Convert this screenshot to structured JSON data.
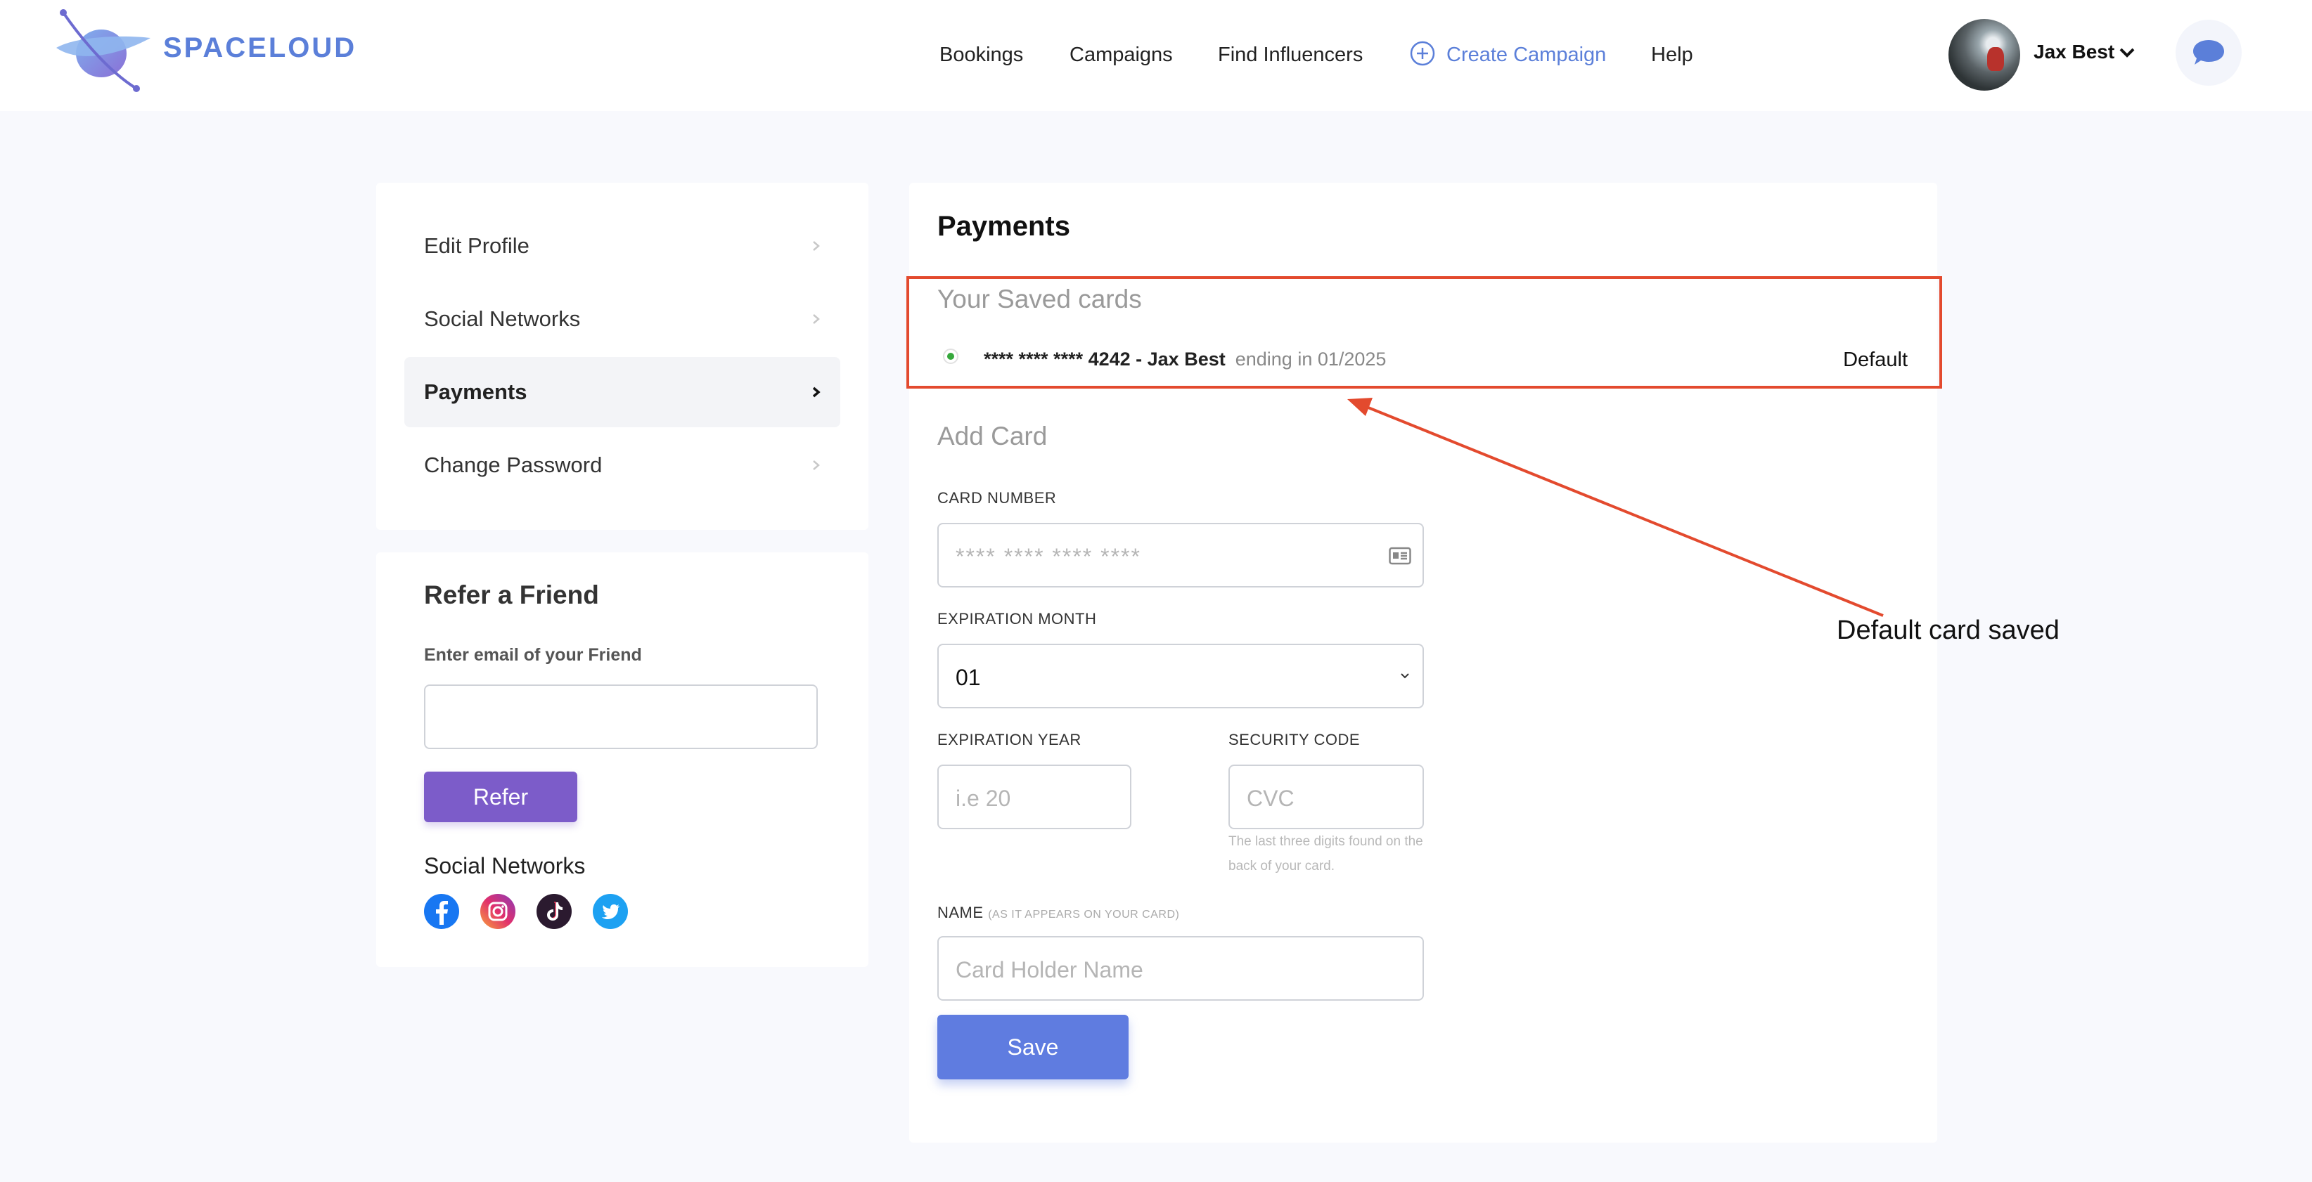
{
  "header": {
    "brand": "SPACELOUD",
    "nav": {
      "bookings": "Bookings",
      "campaigns": "Campaigns",
      "find_influencers": "Find Influencers",
      "create_campaign": "Create Campaign",
      "help": "Help"
    },
    "user": {
      "name": "Jax Best"
    }
  },
  "sidebar": {
    "items": [
      {
        "label": "Edit Profile",
        "active": false
      },
      {
        "label": "Social Networks",
        "active": false
      },
      {
        "label": "Payments",
        "active": true
      },
      {
        "label": "Change Password",
        "active": false
      }
    ]
  },
  "refer": {
    "title": "Refer a Friend",
    "email_label": "Enter email of your Friend",
    "email_value": "",
    "button": "Refer",
    "social_title": "Social Networks",
    "social_icons": [
      "facebook-icon",
      "instagram-icon",
      "tiktok-icon",
      "twitter-icon"
    ]
  },
  "payments": {
    "title": "Payments",
    "saved_title": "Your Saved cards",
    "saved_card": {
      "number": "**** **** **** 4242 - Jax Best",
      "expiry": "ending in 01/2025",
      "default_label": "Default"
    },
    "add_title": "Add Card",
    "card_number": {
      "label": "CARD NUMBER",
      "placeholder": "****    ****    ****    ****"
    },
    "exp_month": {
      "label": "EXPIRATION MONTH",
      "value": "01"
    },
    "exp_year": {
      "label": "EXPIRATION YEAR",
      "placeholder": "i.e 20"
    },
    "security": {
      "label": "SECURITY CODE",
      "placeholder": "CVC",
      "note": "The last three digits found on the back of your card."
    },
    "name": {
      "label": "NAME",
      "hint": "(AS IT APPEARS ON YOUR CARD)",
      "placeholder": "Card Holder Name"
    },
    "save_button": "Save"
  },
  "annotation": {
    "text": "Default card saved",
    "color": "#e34a2e"
  },
  "colors": {
    "brand": "#5b7fd9",
    "refer_button": "#7c5cc9",
    "save_button": "#5f7ce0",
    "default_dot": "#36a83c"
  }
}
